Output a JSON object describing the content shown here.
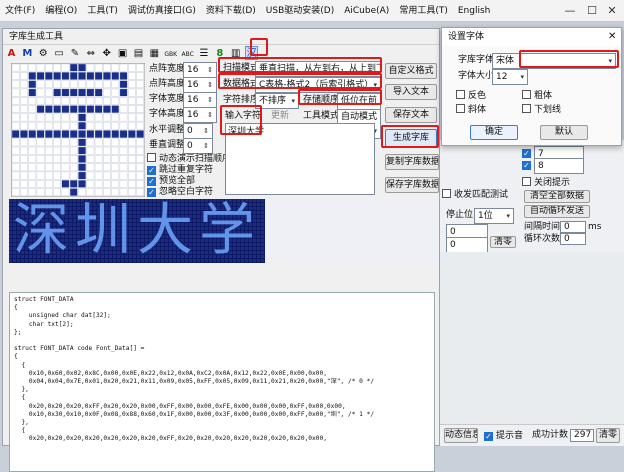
{
  "menu": [
    "文件(F)",
    "编程(O)",
    "工具(T)",
    "调试仿真接口(G)",
    "资料下载(D)",
    "USB驱动安装(D)",
    "AiCube(A)",
    "常用工具(T)",
    "English"
  ],
  "font_tool": {
    "title": "字库生成工具",
    "toolbar_text": {
      "gbk": "GBK",
      "abc": "ABC",
      "num": "8",
      "han": "汉"
    },
    "params": [
      {
        "label": "点阵宽度",
        "value": "16"
      },
      {
        "label": "点阵高度",
        "value": "16"
      },
      {
        "label": "字体宽度",
        "value": "16"
      },
      {
        "label": "字体高度",
        "value": "16"
      }
    ],
    "offset_h": {
      "label": "水平调整",
      "value": "0"
    },
    "offset_v": {
      "label": "垂直调整",
      "value": "0"
    },
    "checks": [
      {
        "label": "动态演示扫描顺序",
        "checked": false
      },
      {
        "label": "跳过重复字符",
        "checked": true
      },
      {
        "label": "预览全部",
        "checked": true
      },
      {
        "label": "忽略空白字符",
        "checked": true
      }
    ],
    "scan_mode": {
      "label": "扫描模式",
      "value": "垂直扫描，从左到右，从上到下"
    },
    "data_format": {
      "label": "数据格式",
      "value": "C表格-格式2（后索引格式）"
    },
    "char_sort": {
      "label": "字符排序",
      "value": "不排序"
    },
    "store_order": {
      "label": "存储顺序",
      "value": "低位在前"
    },
    "update_label": "更新",
    "tool_mode": {
      "label": "工具模式",
      "value": "自动模式"
    },
    "input_label": "输入字符",
    "input_value": "深圳大学",
    "buttons": {
      "custom": "自定义格式",
      "import": "导入文本",
      "save_text": "保存文本",
      "generate": "生成字库",
      "copy": "复制字库数据",
      "save_data": "保存字库数据"
    },
    "preview_text": "深圳大学",
    "code_lines": [
      "struct FONT_DATA",
      "{",
      "    unsigned char dat[32];",
      "    char txt[2];",
      "};",
      "",
      "struct FONT_DATA code Font_Data[] =",
      "{",
      "  {",
      "    0x10,0x60,0x02,0x8C,0x00,0x0E,0x22,0x12,0x0A,0xC2,0x0A,0x12,0x22,0x0E,0x00,0x00,",
      "    0x04,0x04,0x7E,0x01,0x20,0x21,0x11,0x09,0x05,0xFF,0x05,0x09,0x11,0x21,0x20,0x00,\"深\", /* 0 */",
      "  },",
      "  {",
      "    0x20,0x20,0x20,0xFF,0x20,0x20,0x00,0xFF,0x00,0x00,0xFE,0x00,0x00,0x00,0xFF,0x00,0x00,",
      "    0x10,0x30,0x10,0x0F,0x08,0x88,0x60,0x1F,0x00,0x00,0x3F,0x00,0x00,0x00,0xFF,0x00,\"圳\", /* 1 */",
      "  },",
      "  {",
      "    0x20,0x20,0x20,0x20,0x20,0x20,0x20,0xFF,0x20,0x20,0x20,0x20,0x20,0x20,0x20,0x00,"
    ]
  },
  "font_dialog": {
    "title": "设置字体",
    "font_name": {
      "label": "字库字体",
      "value": "宋体"
    },
    "font_size": {
      "label": "字体大小",
      "value": "12"
    },
    "checks": [
      {
        "label": "反色",
        "checked": false
      },
      {
        "label": "粗体",
        "checked": false
      },
      {
        "label": "斜体",
        "checked": false
      },
      {
        "label": "下划线",
        "checked": false
      }
    ],
    "ok": "确定",
    "default": "默认"
  },
  "back_panel": {
    "field1": "7",
    "field2": "8",
    "close_hint": "关闭提示",
    "clear_all": "清空全部数据",
    "auto_loop": "自动循环发送",
    "interval_label": "间隔时间",
    "interval_value": "0",
    "interval_unit": "ms",
    "loop_label": "循环次数",
    "loop_value": "0",
    "recv_match": "收发匹配测试",
    "stop_label": "停止位",
    "stop_value": "1位",
    "c1": "0",
    "c2": "0",
    "clear": "清零"
  },
  "status": {
    "anim": "动态信息",
    "sound": "提示音",
    "success_label": "成功计数",
    "success_value": "297",
    "clear": "清零"
  }
}
